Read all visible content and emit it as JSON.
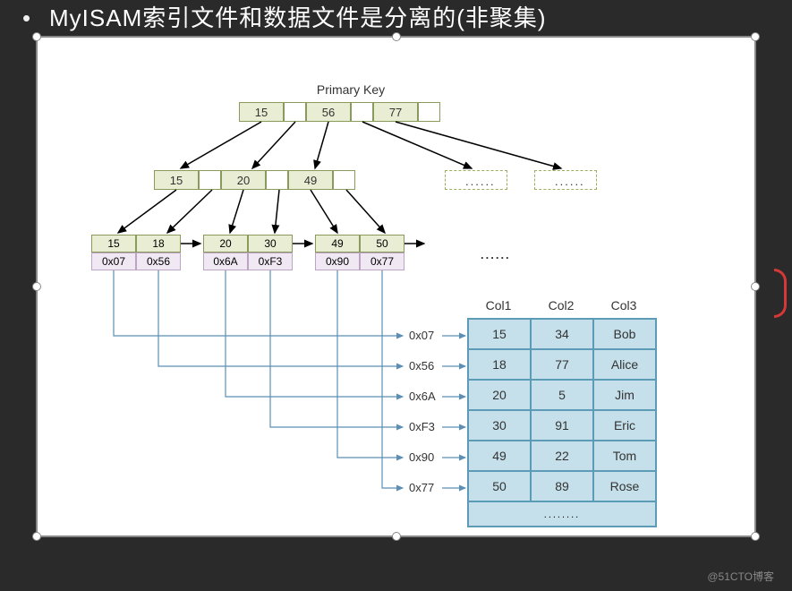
{
  "title": "MyISAM索引文件和数据文件是分离的(非聚集)",
  "primary_key_label": "Primary Key",
  "root": {
    "keys": [
      "15",
      "56",
      "77"
    ]
  },
  "level2": {
    "keys": [
      "15",
      "20",
      "49"
    ]
  },
  "leaves": [
    {
      "keys": [
        "15",
        "18"
      ],
      "ptrs": [
        "0x07",
        "0x56"
      ]
    },
    {
      "keys": [
        "20",
        "30"
      ],
      "ptrs": [
        "0x6A",
        "0xF3"
      ]
    },
    {
      "keys": [
        "49",
        "50"
      ],
      "ptrs": [
        "0x90",
        "0x77"
      ]
    }
  ],
  "addresses": [
    "0x07",
    "0x56",
    "0x6A",
    "0xF3",
    "0x90",
    "0x77"
  ],
  "table": {
    "headers": [
      "Col1",
      "Col2",
      "Col3"
    ],
    "rows": [
      [
        "15",
        "34",
        "Bob"
      ],
      [
        "18",
        "77",
        "Alice"
      ],
      [
        "20",
        "5",
        "Jim"
      ],
      [
        "30",
        "91",
        "Eric"
      ],
      [
        "49",
        "22",
        "Tom"
      ],
      [
        "50",
        "89",
        "Rose"
      ]
    ],
    "footer": "........"
  },
  "ellipsis_dashed": "......",
  "leaf_dots": "......",
  "watermark": "@51CTO博客"
}
